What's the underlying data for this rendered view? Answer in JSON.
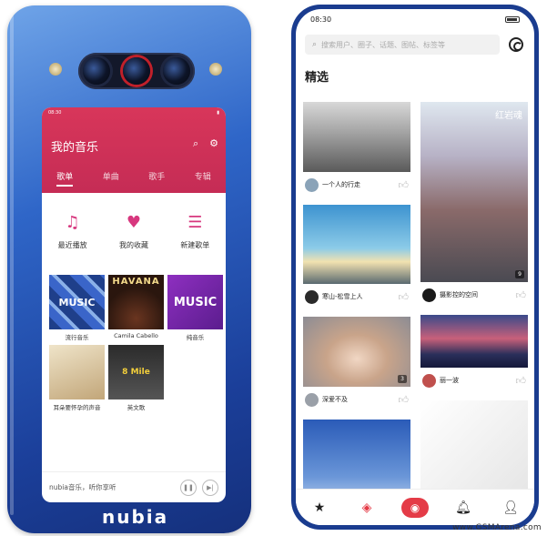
{
  "back_screen": {
    "status_time": "08:30",
    "title": "我的音乐",
    "tabs": [
      "歌单",
      "单曲",
      "歌手",
      "专辑"
    ],
    "shortcuts": [
      "最近播放",
      "我的收藏",
      "新建歌单"
    ],
    "albums": [
      {
        "art_text": "MUSIC",
        "caption": "流行音乐"
      },
      {
        "art_text": "HAVANA",
        "caption": "Camila Cabello"
      },
      {
        "art_text": "MUSIC",
        "caption": "纯音乐"
      },
      {
        "art_text": "",
        "caption": "耳朵要怀孕的声音"
      },
      {
        "art_text": "8 Mile",
        "caption": "英文歌"
      },
      {
        "art_text": "",
        "caption": ""
      }
    ],
    "player_text": "nubia音乐，听你享听"
  },
  "brand": "nubia",
  "front_screen": {
    "status_time": "08:30",
    "search_placeholder": "搜索用户、圈子、话题、图帖、标签等",
    "section_title": "精选",
    "left_cards": [
      {
        "label": "一个人的行走",
        "count": ""
      },
      {
        "label": "寒山-松雪上人",
        "count": ""
      },
      {
        "label": "深爱不及",
        "count": "3"
      },
      {
        "label": "",
        "count": ""
      }
    ],
    "right_cards": [
      {
        "label": "摄影控的空间",
        "count": "9",
        "overlay": "红岩魂"
      },
      {
        "label": "丽一波",
        "count": ""
      },
      {
        "label": "",
        "count": ""
      }
    ]
  },
  "watermark": "www.GSMArena.com",
  "colors": {
    "accent_red": "#e43b47",
    "music_header": "#c52c55",
    "phone_blue": "#1b3f9a"
  },
  "icons": [
    "search-icon",
    "settings-icon",
    "music-note-icon",
    "heart-icon",
    "playlist-add-icon",
    "pause-icon",
    "next-icon",
    "like-icon",
    "star-icon",
    "compass-icon",
    "nubia-logo-icon",
    "bell-icon",
    "user-icon"
  ]
}
